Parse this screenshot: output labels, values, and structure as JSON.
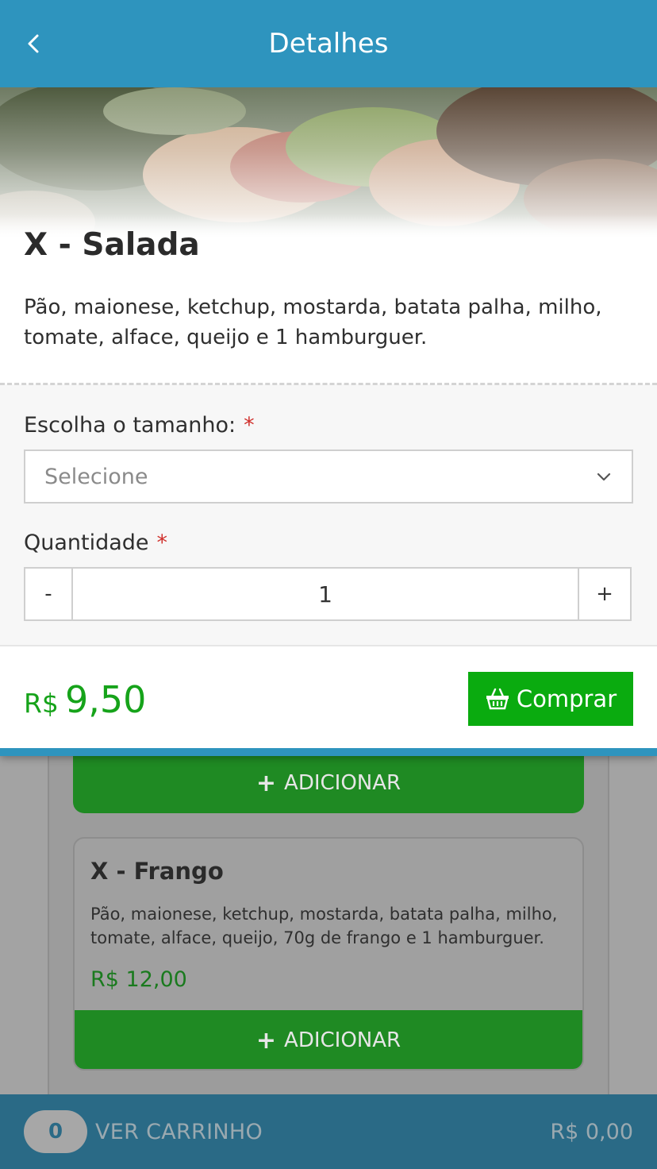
{
  "header": {
    "title": "Detalhes"
  },
  "product": {
    "name": "X - Salada",
    "description": "Pão, maionese, ketchup, mostarda, batata palha, milho, tomate, alface, queijo e 1 hamburguer."
  },
  "size_field": {
    "label": "Escolha o tamanho:",
    "required_mark": "*",
    "placeholder": "Selecione"
  },
  "quantity_field": {
    "label": "Quantidade",
    "required_mark": "*",
    "minus": "-",
    "value": "1",
    "plus": "+"
  },
  "price": {
    "currency": "R$",
    "value": "9,50"
  },
  "buy_button": {
    "label": "Comprar"
  },
  "background_list": {
    "add_label": "ADICIONAR",
    "items": [
      {
        "name": "X - Frango",
        "description": "Pão, maionese, ketchup, mostarda, batata palha, milho, tomate, alface, queijo, 70g de frango e 1 hamburguer.",
        "price": "R$ 12,00"
      }
    ]
  },
  "cart": {
    "count": "0",
    "label": "VER CARRINHO",
    "total": "R$ 0,00"
  },
  "colors": {
    "primary": "#2e94be",
    "success": "#0aab0f",
    "price_green": "#16a31a",
    "required": "#d0312d"
  },
  "icons": {
    "back": "chevron-left-icon",
    "dropdown": "chevron-down-icon",
    "basket": "basket-icon",
    "plus": "plus-icon"
  }
}
